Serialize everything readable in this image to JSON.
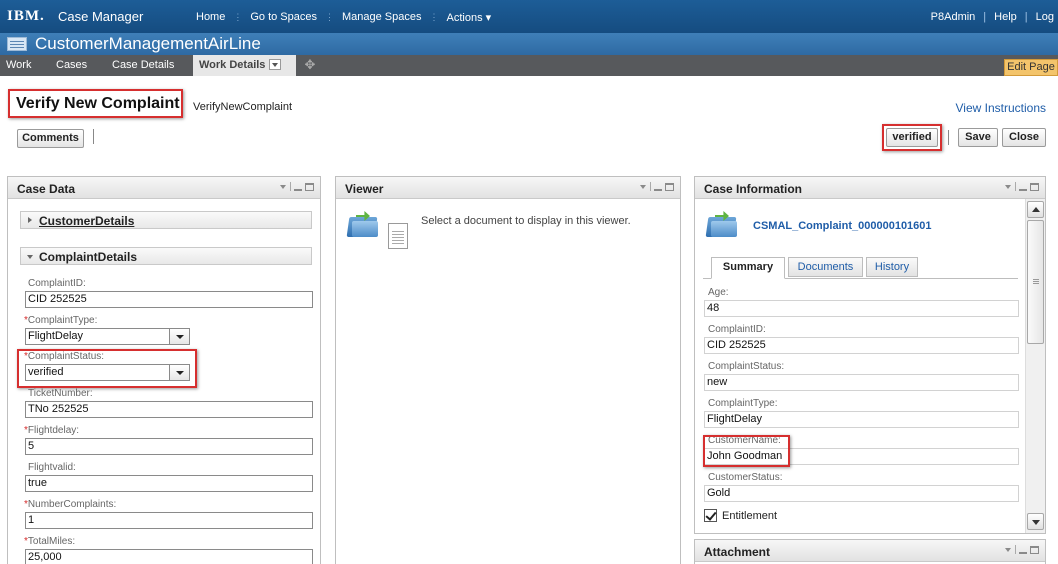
{
  "topbar": {
    "logo": "IBM.",
    "product": "Case Manager",
    "nav": [
      "Home",
      "Go to Spaces",
      "Manage Spaces",
      "Actions ▾"
    ],
    "user": "P8Admin",
    "help": "Help",
    "logout": "Log"
  },
  "solution": {
    "title": "CustomerManagementAirLine"
  },
  "tabs": {
    "work": "Work",
    "cases": "Cases",
    "case_details": "Case Details",
    "work_details": "Work Details",
    "edit_page": "Edit Page"
  },
  "header": {
    "title": "Verify New Complaint",
    "step": "VerifyNewComplaint",
    "view_instructions": "View Instructions"
  },
  "toolbar": {
    "comments": "Comments",
    "verified": "verified",
    "save": "Save",
    "close": "Close"
  },
  "case_data": {
    "title": "Case Data",
    "sections": {
      "customer": "CustomerDetails",
      "complaint": "ComplaintDetails"
    },
    "fields": {
      "complaint_id": {
        "label": "ComplaintID:",
        "value": "CID 252525"
      },
      "complaint_type": {
        "label": "ComplaintType:",
        "value": "FlightDelay"
      },
      "complaint_status": {
        "label": "ComplaintStatus:",
        "value": "verified"
      },
      "ticket_number": {
        "label": "TicketNumber:",
        "value": "TNo 252525"
      },
      "flight_delay": {
        "label": "Flightdelay:",
        "value": "5"
      },
      "flight_valid": {
        "label": "Flightvalid:",
        "value": "true"
      },
      "number_complaints": {
        "label": "NumberComplaints:",
        "value": "1"
      },
      "total_miles": {
        "label": "TotalMiles:",
        "value": "25,000"
      }
    },
    "required_mark": "*"
  },
  "viewer": {
    "title": "Viewer",
    "message": "Select a document to display in this viewer."
  },
  "case_info": {
    "title": "Case Information",
    "case_id": "CSMAL_Complaint_000000101601",
    "tabs": {
      "summary": "Summary",
      "documents": "Documents",
      "history": "History"
    },
    "fields": {
      "age": {
        "label": "Age:",
        "value": "48"
      },
      "complaint_id": {
        "label": "ComplaintID:",
        "value": "CID 252525"
      },
      "complaint_status": {
        "label": "ComplaintStatus:",
        "value": "new"
      },
      "complaint_type": {
        "label": "ComplaintType:",
        "value": "FlightDelay"
      },
      "customer_name": {
        "label": "CustomerName:",
        "value": "John Goodman"
      },
      "customer_status": {
        "label": "CustomerStatus:",
        "value": "Gold"
      }
    },
    "entitlement": "Entitlement"
  },
  "attachment": {
    "title": "Attachment"
  }
}
